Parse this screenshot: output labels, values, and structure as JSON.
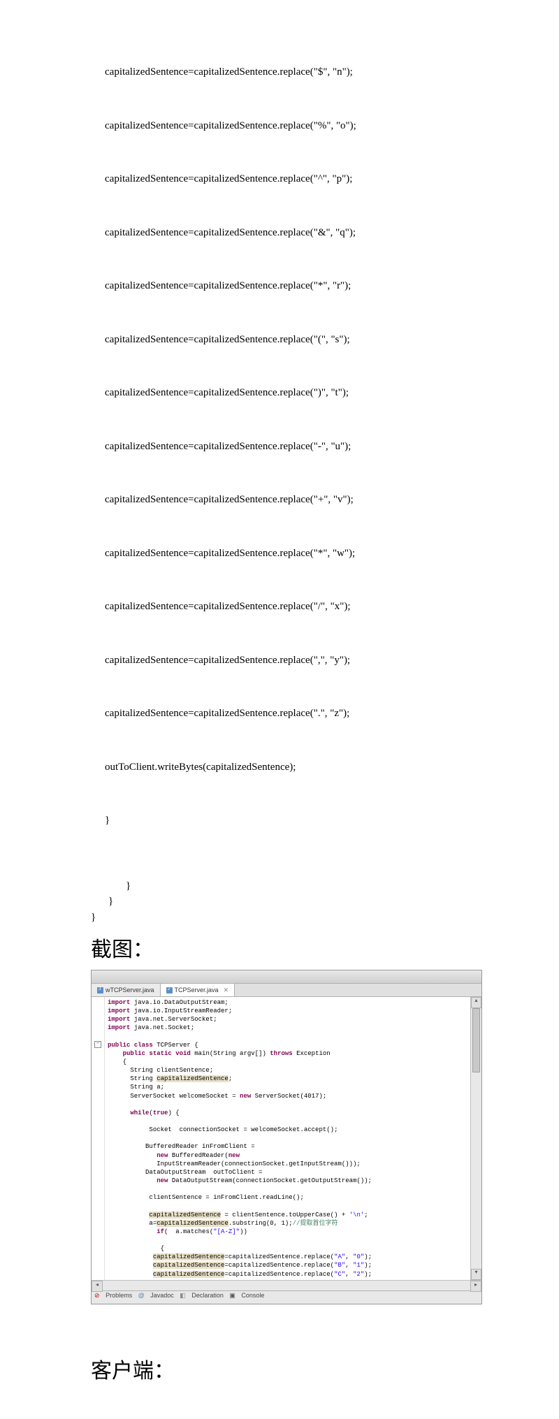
{
  "code_top": {
    "lines": [
      "capitalizedSentence=capitalizedSentence.replace(\"$\", \"n\");",
      "capitalizedSentence=capitalizedSentence.replace(\"%\", \"o\");",
      "capitalizedSentence=capitalizedSentence.replace(\"^\", \"p\");",
      "capitalizedSentence=capitalizedSentence.replace(\"&\", \"q\");",
      "capitalizedSentence=capitalizedSentence.replace(\"*\", \"r\");",
      "capitalizedSentence=capitalizedSentence.replace(\"(\", \"s\");",
      "capitalizedSentence=capitalizedSentence.replace(\")\", \"t\");",
      "capitalizedSentence=capitalizedSentence.replace(\"-\", \"u\");",
      "capitalizedSentence=capitalizedSentence.replace(\"+\", \"v\");",
      "capitalizedSentence=capitalizedSentence.replace(\"*\", \"w\");",
      "capitalizedSentence=capitalizedSentence.replace(\"/\", \"x\");",
      "capitalizedSentence=capitalizedSentence.replace(\",\", \"y\");",
      "capitalizedSentence=capitalizedSentence.replace(\".\", \"z\");",
      "outToClient.writeBytes(capitalizedSentence);",
      "}"
    ]
  },
  "closing": {
    "b1": "}",
    "b2": "}",
    "b3": "}"
  },
  "heading_screenshot": "截图：",
  "heading_client": "客户端：",
  "ide": {
    "tab1": "wTCPServer.java",
    "tab2": "TCPServer.java",
    "bottom_tabs": [
      "Problems",
      "Javadoc",
      "Declaration",
      "Console"
    ],
    "code": {
      "l1_kw": "import",
      "l1": " java.io.DataOutputStream;",
      "l2_kw": "import",
      "l2": " java.io.InputStreamReader;",
      "l3_kw": "import",
      "l3": " java.net.ServerSocket;",
      "l4_kw": "import",
      "l4": " java.net.Socket;",
      "l5_kw1": "public",
      "l5_kw2": "class",
      "l5": " TCPServer {",
      "l6_kw1": "public",
      "l6_kw2": "static",
      "l6_kw3": "void",
      "l6_mid": " main(String argv[]) ",
      "l6_kw4": "throws",
      "l6_end": " Exception",
      "l7": "{",
      "l8": "String clientSentence;",
      "l9a": "String ",
      "l9b": "capitalizedSentence",
      "l9c": ";",
      "l10": "String a;",
      "l11a": "ServerSocket welcomeSocket = ",
      "l11_kw": "new",
      "l11b": " ServerSocket(4017);",
      "l12_kw": "while",
      "l12a": "(",
      "l12_kw2": "true",
      "l12b": ") {",
      "l13": "Socket  connectionSocket = welcomeSocket.accept();",
      "l14": "BufferedReader inFromClient =",
      "l15_kw": "new",
      "l15a": " BufferedReader(",
      "l15_kw2": "new",
      "l16": "InputStreamReader(connectionSocket.getInputStream()));",
      "l17": "DataOutputStream  outToClient =",
      "l18_kw": "new",
      "l18": " DataOutputStream(connectionSocket.getOutputStream());",
      "l19": "clientSentence = inFromClient.readLine();",
      "l20a": "capitalizedSentence",
      "l20b": " = clientSentence.toUpperCase() + ",
      "l20c": "'\\n'",
      "l20d": ";",
      "l21a": "a=",
      "l21b": "capitalizedSentence",
      "l21c": ".substring(0, 1);",
      "l21d": "//提取首位字符",
      "l22_kw": "if",
      "l22a": "(  a.matches(",
      "l22b": "\"[A-Z]\"",
      "l22c": "))",
      "l23": "{",
      "l24a": "capitalizedSentence",
      "l24b": "=capitalizedSentence.replace(",
      "l24c": "\"A\"",
      "l24d": ", ",
      "l24e": "\"0\"",
      "l24f": ");",
      "l25a": "capitalizedSentence",
      "l25b": "=capitalizedSentence.replace(",
      "l25c": "\"B\"",
      "l25d": ", ",
      "l25e": "\"1\"",
      "l25f": ");",
      "l26a": "capitalizedSentence",
      "l26b": "=capitalizedSentence.replace(",
      "l26c": "\"C\"",
      "l26d": ", ",
      "l26e": "\"2\"",
      "l26f": ");"
    }
  }
}
